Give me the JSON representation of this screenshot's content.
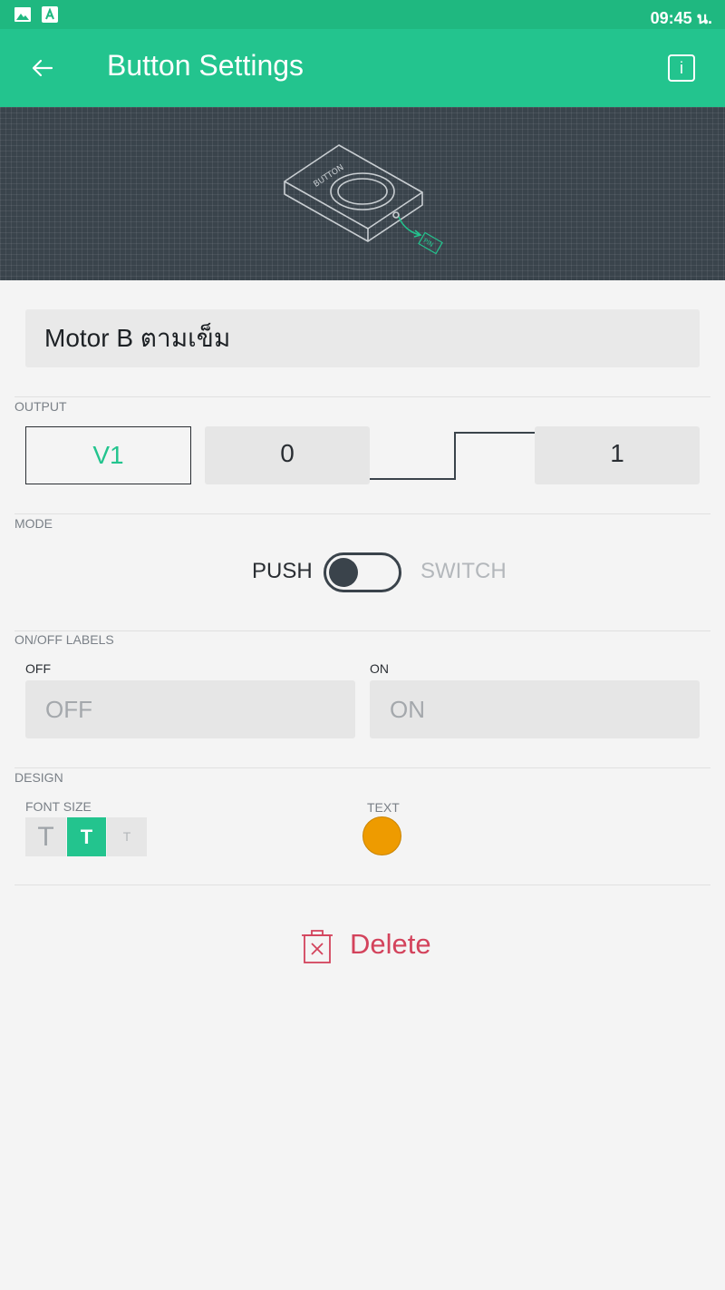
{
  "status_bar": {
    "time": "09:45 น.",
    "icons": [
      "image-icon",
      "app-store-icon"
    ]
  },
  "app_bar": {
    "title": "Button Settings",
    "back_icon": "arrow-left-icon",
    "info_icon": "info-icon",
    "info_glyph": "i"
  },
  "hero": {
    "device_label": "BUTTON",
    "pin_label": "PIN"
  },
  "widget_name": "Motor B ตามเข็ม",
  "output": {
    "section_label": "OUTPUT",
    "pin": "V1",
    "low_value": "0",
    "high_value": "1"
  },
  "mode": {
    "section_label": "MODE",
    "push_label": "PUSH",
    "switch_label": "SWITCH",
    "selected": "PUSH"
  },
  "onoff_labels": {
    "section_label": "ON/OFF LABELS",
    "off_label": "OFF",
    "off_placeholder": "OFF",
    "on_label": "ON",
    "on_placeholder": "ON"
  },
  "design": {
    "section_label": "DESIGN",
    "font_size_label": "FONT SIZE",
    "font_sizes": [
      "T",
      "T",
      "T"
    ],
    "selected_font_size": 1,
    "text_label": "TEXT",
    "text_color": "#ee9b00"
  },
  "delete": {
    "label": "Delete",
    "icon": "trash-icon"
  },
  "colors": {
    "accent": "#23c48e",
    "statusbar": "#1fb880",
    "danger": "#d3435c",
    "dark": "#3a434b"
  }
}
